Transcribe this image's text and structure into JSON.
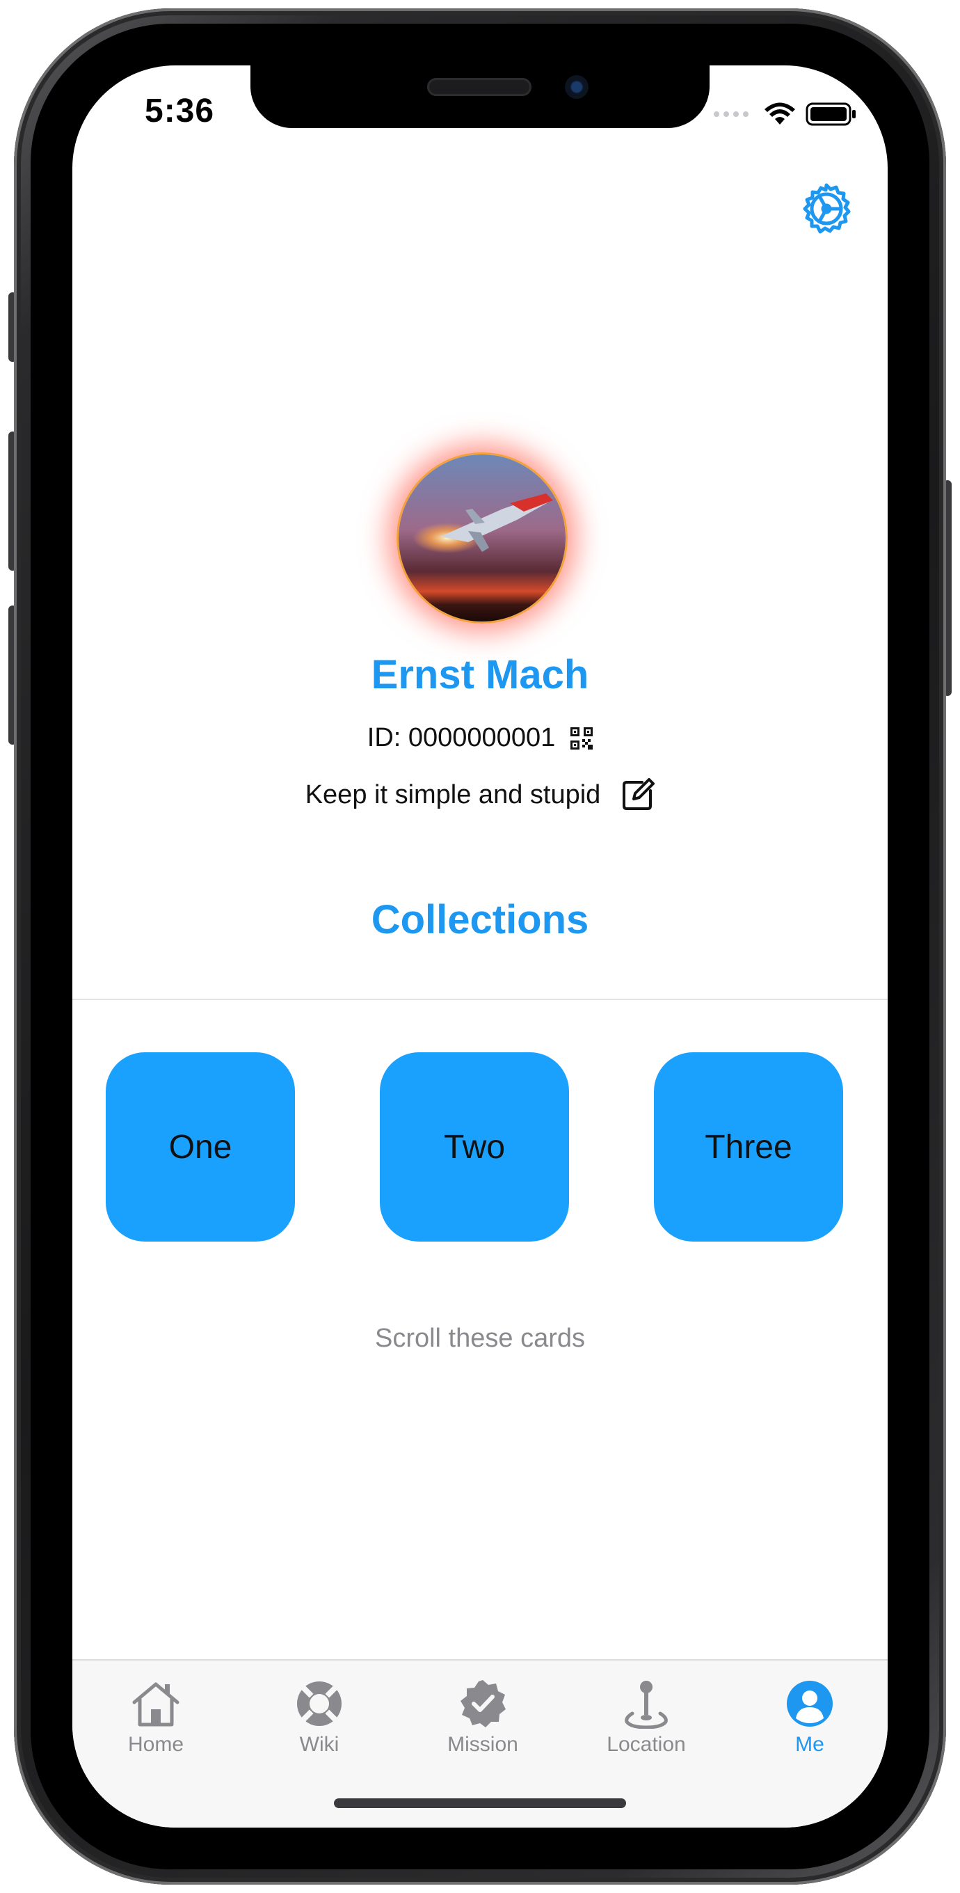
{
  "status_bar": {
    "time": "5:36"
  },
  "header": {
    "settings_icon": "gear-icon"
  },
  "profile": {
    "name": "Ernst Mach",
    "id_text": "ID: 0000000001",
    "motto": "Keep it simple and stupid"
  },
  "collections": {
    "title": "Collections",
    "cards": [
      "One",
      "Two",
      "Three"
    ],
    "hint": "Scroll these cards"
  },
  "tabbar": {
    "tabs": [
      {
        "label": "Home",
        "icon": "house-icon"
      },
      {
        "label": "Wiki",
        "icon": "lifebuoy-icon"
      },
      {
        "label": "Mission",
        "icon": "checkmark-seal-icon"
      },
      {
        "label": "Location",
        "icon": "joystick-icon"
      },
      {
        "label": "Me",
        "icon": "person-circle-icon"
      }
    ],
    "active_index": 4
  },
  "colors": {
    "accent": "#1d97f0",
    "card": "#1aa1fe",
    "inactive": "#8a8a8e"
  }
}
